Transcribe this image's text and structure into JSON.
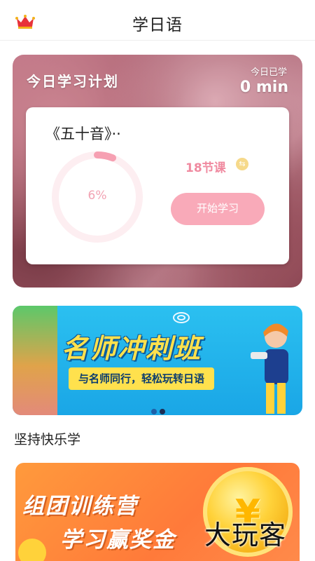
{
  "header": {
    "title": "学日语",
    "vip_icon": "crown-icon"
  },
  "plan": {
    "title": "今日学习计划",
    "today_label": "今日已学",
    "today_value": "0 min",
    "course": {
      "name": "《五十音》··",
      "progress_percent": 6,
      "progress_label": "6%",
      "lessons": "18节课",
      "switch_icon": "switch-icon",
      "start_button": "开始学习"
    }
  },
  "banner": {
    "title": "名师冲刺班",
    "subtitle": "与名师同行，轻松玩转日语",
    "active_dot": 1,
    "dot_count": 2
  },
  "section": {
    "title": "坚持快乐学"
  },
  "promo": {
    "line1": "组团训练营",
    "line2": "学习赢奖金",
    "coin_symbol": "¥"
  },
  "watermark": "大玩客",
  "colors": {
    "accent_pink": "#f9aab9",
    "ring_pink": "#f6a0b2",
    "banner_blue": "#1aa6e6",
    "banner_yellow": "#ffe14d",
    "promo_orange": "#ff7a3a"
  }
}
